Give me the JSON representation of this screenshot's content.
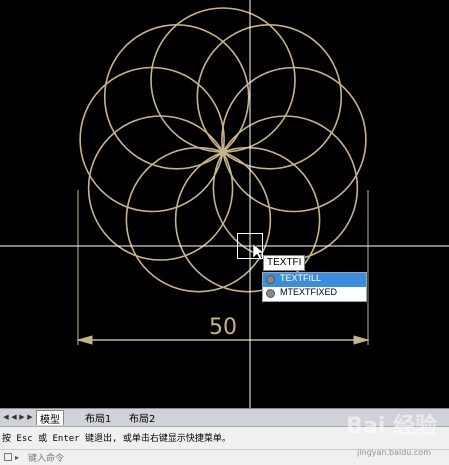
{
  "drawing": {
    "dimension_value": "50",
    "line_color": "#c8b48a",
    "crosshair_color": "#ffffff"
  },
  "command_input": {
    "value": "TEXTFI"
  },
  "suggestions": [
    {
      "label": "TEXTFILL",
      "selected": true
    },
    {
      "label": "MTEXTFIXED",
      "selected": false
    }
  ],
  "tabs": {
    "model": "模型",
    "layout1": "布局1",
    "layout2": "布局2"
  },
  "command_line": {
    "history": "按 Esc 或 Enter 键退出, 或单击右键显示快捷菜单。",
    "prompt": "键入命令"
  },
  "watermark": {
    "text": "Bai   经验",
    "url": "jingyan.baidu.com"
  }
}
